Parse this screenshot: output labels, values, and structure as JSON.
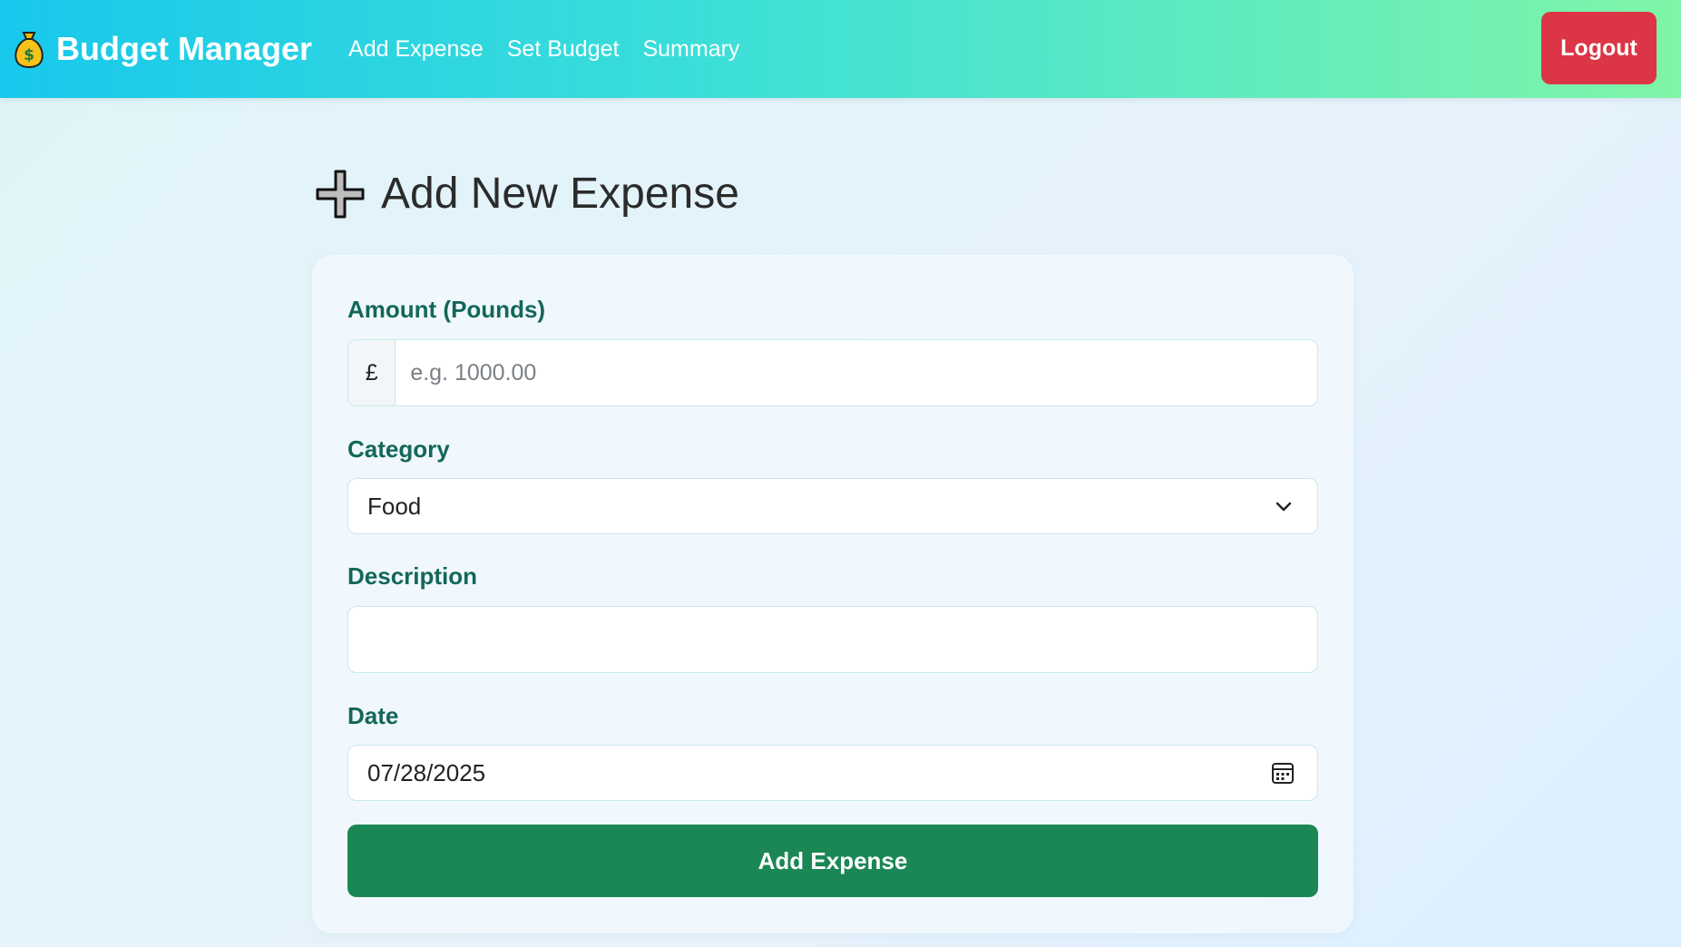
{
  "navbar": {
    "brand": "Budget Manager",
    "brand_icon": "money-bag-icon",
    "links": [
      "Add Expense",
      "Set Budget",
      "Summary"
    ],
    "logout_label": "Logout",
    "logout_color": "#dc3545"
  },
  "page": {
    "title": "Add New Expense",
    "title_icon": "plus-icon"
  },
  "form": {
    "amount_label": "Amount (Pounds)",
    "amount_prefix": "£",
    "amount_placeholder": "e.g. 1000.00",
    "amount_value": "",
    "category_label": "Category",
    "category_value": "Food",
    "description_label": "Description",
    "description_value": "",
    "date_label": "Date",
    "date_value": "07/28/2025",
    "submit_label": "Add Expense",
    "submit_color": "#1b8755"
  }
}
